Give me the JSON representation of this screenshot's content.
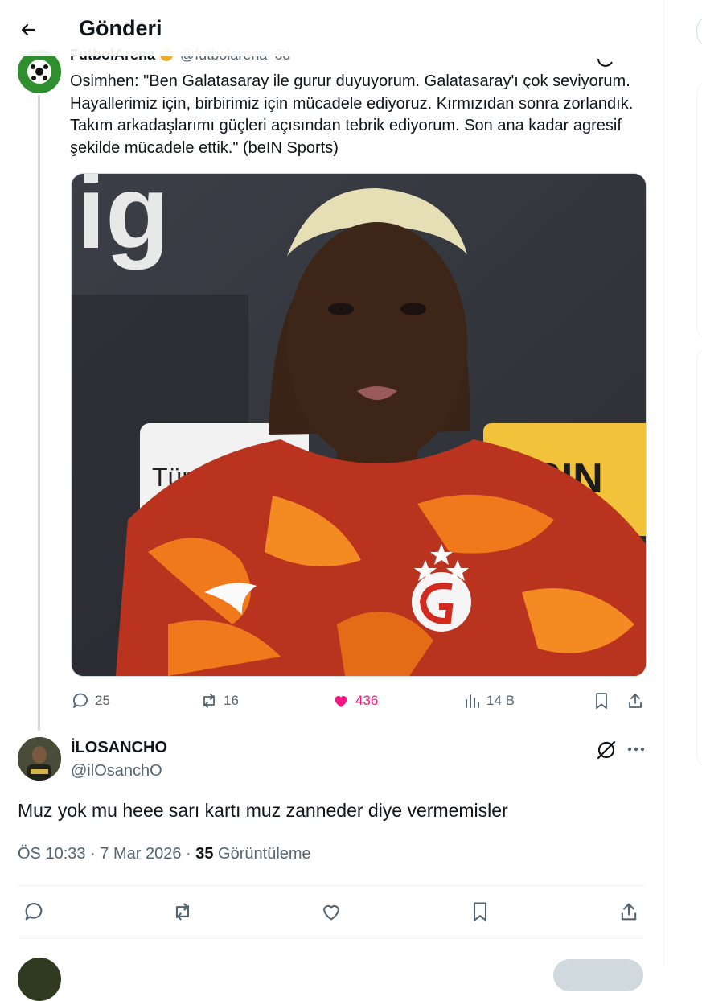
{
  "header": {
    "title": "Gönderi"
  },
  "quoted": {
    "author_name": "FutbolArena",
    "author_handle": "@futbolarena",
    "age": "6d",
    "text": "Osimhen: \"Ben Galatasaray ile gurur duyuyorum. Galatasaray'ı çok seviyorum. Hayallerimiz için, birbirimiz için mücadele ediyoruz. Kırmızıdan sonra zorlandık. Takım arkadaşlarımı güçleri açısından tebrik ediyorum. Son ana kadar agresif şekilde mücadele ettik.\" (beIN Sports)",
    "media": {
      "sign_left": "lig",
      "sign_board_left": "Tür",
      "sign_board_right": "IESIN"
    },
    "actions": {
      "replies": "25",
      "reposts": "16",
      "likes": "436",
      "views": "14 B"
    },
    "colors": {
      "like": "#f91880",
      "muted": "#536471"
    }
  },
  "reply": {
    "name": "İLOSANCHO",
    "handle": "@ilOsanchO",
    "text": "Muz yok mu heee sarı kartı muz zanneder diye vermemisler",
    "time": "ÖS 10:33 · 7 Mar 2026 ·",
    "views_count": "35",
    "views_label": "Görüntüleme"
  },
  "icons": {
    "back": "arrow-left-icon",
    "reply": "comment-icon",
    "repost": "repost-icon",
    "like": "heart-icon",
    "views": "bar-chart-icon",
    "bookmark": "bookmark-icon",
    "share": "share-icon",
    "grok": "grok-icon",
    "more": "more-icon"
  }
}
